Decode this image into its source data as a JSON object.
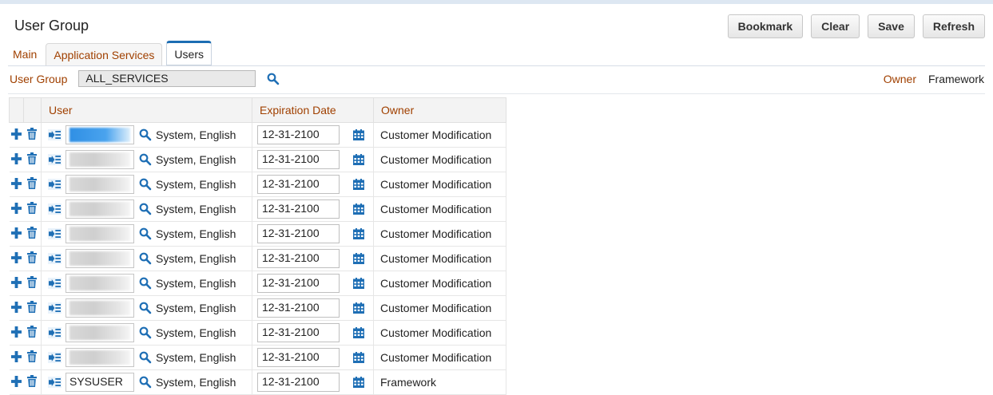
{
  "page": {
    "title": "User Group"
  },
  "toolbar": {
    "bookmark": "Bookmark",
    "clear": "Clear",
    "save": "Save",
    "refresh": "Refresh"
  },
  "tabs": [
    {
      "label": "Main"
    },
    {
      "label": "Application Services"
    },
    {
      "label": "Users"
    }
  ],
  "group": {
    "label": "User Group",
    "value": "ALL_SERVICES"
  },
  "owner": {
    "label": "Owner",
    "value": "Framework"
  },
  "grid": {
    "headers": {
      "user": "User",
      "expiration": "Expiration Date",
      "owner": "Owner"
    },
    "rows": [
      {
        "user": "",
        "lang": "System, English",
        "date": "12-31-2100",
        "owner": "Customer Modification"
      },
      {
        "user": "",
        "lang": "System, English",
        "date": "12-31-2100",
        "owner": "Customer Modification"
      },
      {
        "user": "",
        "lang": "System, English",
        "date": "12-31-2100",
        "owner": "Customer Modification"
      },
      {
        "user": "",
        "lang": "System, English",
        "date": "12-31-2100",
        "owner": "Customer Modification"
      },
      {
        "user": "",
        "lang": "System, English",
        "date": "12-31-2100",
        "owner": "Customer Modification"
      },
      {
        "user": "",
        "lang": "System, English",
        "date": "12-31-2100",
        "owner": "Customer Modification"
      },
      {
        "user": "",
        "lang": "System, English",
        "date": "12-31-2100",
        "owner": "Customer Modification"
      },
      {
        "user": "",
        "lang": "System, English",
        "date": "12-31-2100",
        "owner": "Customer Modification"
      },
      {
        "user": "",
        "lang": "System, English",
        "date": "12-31-2100",
        "owner": "Customer Modification"
      },
      {
        "user": "",
        "lang": "System, English",
        "date": "12-31-2100",
        "owner": "Customer Modification"
      },
      {
        "user": "SYSUSER",
        "lang": "System, English",
        "date": "12-31-2100",
        "owner": "Framework"
      }
    ]
  },
  "icons": {
    "add": "plus-icon",
    "delete": "trash-icon",
    "context": "context-menu-icon",
    "search": "search-icon",
    "calendar": "calendar-icon"
  },
  "colors": {
    "accent": "#1c6db3",
    "label": "#a04000",
    "icon": "#1f6fb5"
  }
}
